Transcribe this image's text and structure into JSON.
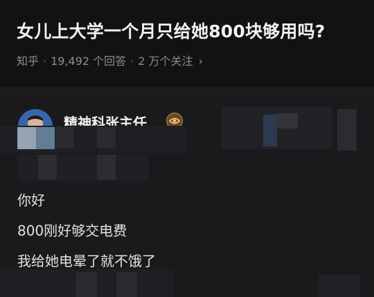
{
  "question": {
    "title": "女儿上大学一个月只给她800块够用吗?",
    "source": "知乎",
    "answers": "19,492 个回答",
    "followers": "2 万个关注"
  },
  "answer": {
    "author_name": "精神科张主任",
    "lines": [
      "你好",
      "800刚好够交电费",
      "我给她电晕了就不饿了"
    ]
  },
  "icons": {
    "badge": "eye-badge-icon",
    "more": "chevron-right-icon"
  }
}
